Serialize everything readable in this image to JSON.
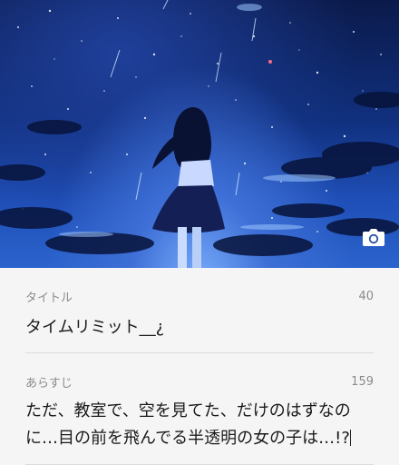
{
  "cover": {
    "image": "starry-night-sky-girl-illustration",
    "camera_icon": "camera-icon"
  },
  "title_field": {
    "label": "タイトル",
    "remaining": "40",
    "value": "タイムリミット__¿"
  },
  "synopsis_field": {
    "label": "あらすじ",
    "remaining": "159",
    "value": "ただ、教室で、空を見てた、だけのはずなのに…目の前を飛んでる半透明の女の子は…!?"
  },
  "colors": {
    "sky_top": "#0b1a4a",
    "sky_bottom": "#2b63cc",
    "background": "#f5f5f5"
  }
}
